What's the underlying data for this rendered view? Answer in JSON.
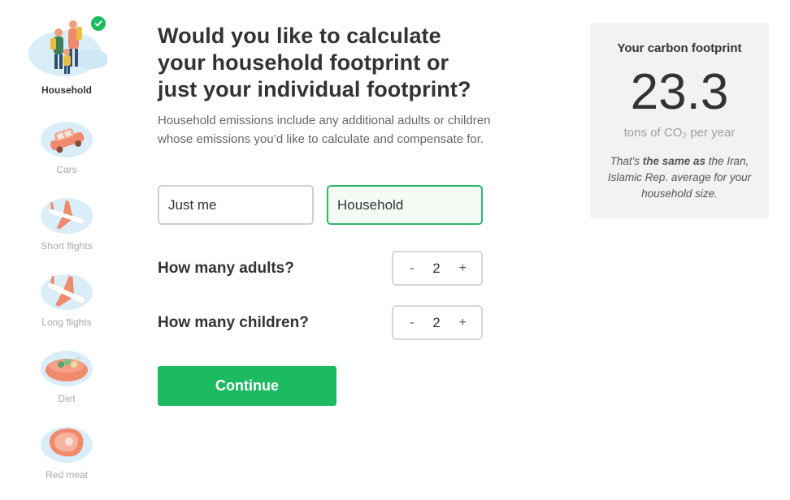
{
  "sidebar": {
    "items": [
      {
        "label": "Household",
        "icon": "family-hiking-icon",
        "active": true,
        "completed": true
      },
      {
        "label": "Cars",
        "icon": "car-icon"
      },
      {
        "label": "Short flights",
        "icon": "airplane-icon"
      },
      {
        "label": "Long flights",
        "icon": "airplane-icon"
      },
      {
        "label": "Diet",
        "icon": "food-bowl-icon"
      },
      {
        "label": "Red meat",
        "icon": "steak-icon"
      }
    ]
  },
  "main": {
    "title": "Would you like to calculate your household footprint or just your individual footprint?",
    "description": "Household emissions include any additional adults or children whose emissions you’d like to calculate and compensate for.",
    "options": {
      "just_me": "Just me",
      "household": "Household",
      "selected": "household"
    },
    "adults": {
      "label": "How many adults?",
      "value": "2",
      "minus": "-",
      "plus": "+"
    },
    "children": {
      "label": "How many children?",
      "value": "2",
      "minus": "-",
      "plus": "+"
    },
    "continue_label": "Continue"
  },
  "footprint": {
    "title": "Your carbon footprint",
    "value": "23.3",
    "unit": "tons of CO₂ per year",
    "note_prefix": "That's ",
    "note_bold": "the same as",
    "note_suffix": " the Iran, Islamic Rep. average for your household size."
  },
  "colors": {
    "accent": "#1dbb61",
    "selected_border": "#2db86a",
    "card_bg": "#f2f2f2",
    "illustration_bg": "#d9eef9",
    "illustration_fg": "#f08a6c"
  }
}
